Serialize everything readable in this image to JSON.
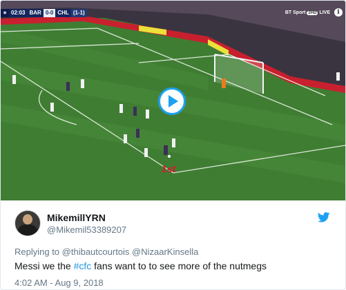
{
  "video": {
    "scorebug": {
      "clock": "02:03",
      "home_team": "BAR",
      "score": "0-0",
      "away_team": "CHL",
      "aggregate": "(1-1)"
    },
    "broadcaster": {
      "name": "BT Sport",
      "channel": "2HD",
      "live": "LIVE"
    },
    "annotation": "1st"
  },
  "tweet": {
    "display_name": "MikemillYRN",
    "handle": "@Mikemil53389207",
    "replying_prefix": "Replying to",
    "reply_mentions": "@thibautcourtois @NizaarKinsella",
    "text_before": "Messi we the ",
    "hashtag": "#cfc",
    "text_after": " fans want to to see more of the nutmegs",
    "timestamp": "4:02 AM - Aug 9, 2018"
  },
  "colors": {
    "twitter_blue": "#1da1f2",
    "hashtag_blue": "#1b95e0",
    "secondary_text": "#657786"
  }
}
